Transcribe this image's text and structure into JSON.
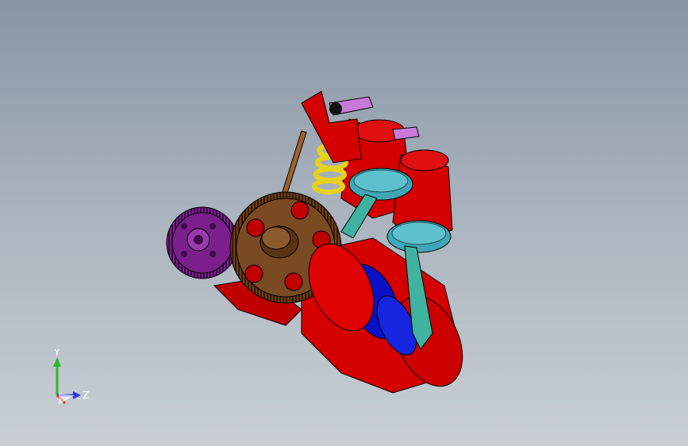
{
  "viewport": {
    "background_top": "#8895a4",
    "background_bottom": "#c9cfd4"
  },
  "model": {
    "colors": {
      "block": "#d40000",
      "block_dark": "#8a0000",
      "crank_bearing": "#0a10c8",
      "piston": "#3fa7b5",
      "conrod": "#3fb3a0",
      "gear_large": "#7a4a22",
      "gear_small": "#7a1f8c",
      "spring": "#e6d21a",
      "rocker": "#c97ad8",
      "pushrod": "#a0602a"
    }
  },
  "triad": {
    "y_label": "Y",
    "z_label": "Z",
    "y_color": "#2bb82b",
    "z_color": "#2a3ad8",
    "x_color": "#d82a2a"
  }
}
